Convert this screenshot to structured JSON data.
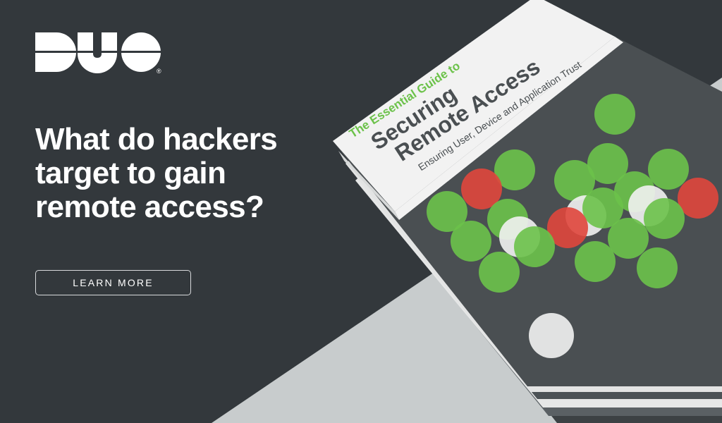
{
  "brand": {
    "logo_text": "DUO",
    "trademark": "®"
  },
  "hero": {
    "headline_lines": [
      "What do hackers",
      "target to gain",
      "remote access?"
    ],
    "cta_label": "LEARN MORE"
  },
  "guide": {
    "kicker": "The Essential Guide to",
    "title_line1": "Securing",
    "title_line2": "Remote Access",
    "subtitle": "Ensuring User, Device and Application Trust"
  },
  "colors": {
    "background": "#33383c",
    "surface": "#c8cccd",
    "accent_green": "#6cc24a",
    "warn_red": "#e0463c",
    "cover_gray": "#4a4f52"
  }
}
